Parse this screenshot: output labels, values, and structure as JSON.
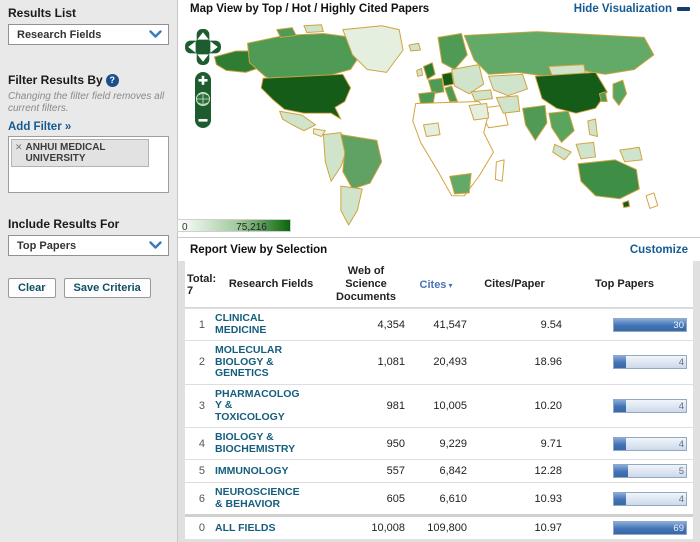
{
  "colors": {
    "link_blue": "#155a93",
    "cites_sort_blue": "#4a74b8",
    "field_link_teal": "#155e7d",
    "map_border_tan": "#d2a23c",
    "map_green_dark": "#145c17",
    "legend_gradient_end": "#0a650a",
    "bar_fill_blue": "#4273b4",
    "sidebar_bg": "#e9e9e9",
    "control_green": "#1d5c2e"
  },
  "sidebar": {
    "results_list_label": "Results List",
    "results_list_value": "Research Fields",
    "filter_heading": "Filter Results By",
    "filter_note": "Changing the filter field removes all current filters.",
    "add_filter_link": "Add Filter »",
    "filter_chip": "ANHUI MEDICAL UNIVERSITY",
    "include_results_label": "Include Results For",
    "include_results_value": "Top Papers",
    "clear_button": "Clear",
    "save_button": "Save Criteria"
  },
  "map": {
    "title": "Map View by Top / Hot / Highly Cited Papers",
    "hide_link": "Hide Visualization",
    "legend_min": "0",
    "legend_max": "75,216"
  },
  "report": {
    "title": "Report View by Selection",
    "customize_link": "Customize",
    "total_label": "Total:",
    "total_value": "7",
    "col_field": "Research Fields",
    "col_docs": "Web of Science Documents",
    "col_cites": "Cites",
    "col_cpp": "Cites/Paper",
    "col_top": "Top Papers",
    "rows": [
      {
        "rank": "1",
        "field": "CLINICAL\nMEDICINE",
        "docs": "4,354",
        "cites": "41,547",
        "cites_per_paper": "9.54",
        "top_papers": "30",
        "bar_fill": 100
      },
      {
        "rank": "2",
        "field": "MOLECULAR\nBIOLOGY &\nGENETICS",
        "docs": "1,081",
        "cites": "20,493",
        "cites_per_paper": "18.96",
        "top_papers": "4",
        "bar_fill": 17
      },
      {
        "rank": "3",
        "field": "PHARMACOLOG\nY &\nTOXICOLOGY",
        "docs": "981",
        "cites": "10,005",
        "cites_per_paper": "10.20",
        "top_papers": "4",
        "bar_fill": 17
      },
      {
        "rank": "4",
        "field": "BIOLOGY &\nBIOCHEMISTRY",
        "docs": "950",
        "cites": "9,229",
        "cites_per_paper": "9.71",
        "top_papers": "4",
        "bar_fill": 17
      },
      {
        "rank": "5",
        "field": "IMMUNOLOGY",
        "docs": "557",
        "cites": "6,842",
        "cites_per_paper": "12.28",
        "top_papers": "5",
        "bar_fill": 20
      },
      {
        "rank": "6",
        "field": "NEUROSCIENCE\n& BEHAVIOR",
        "docs": "605",
        "cites": "6,610",
        "cites_per_paper": "10.93",
        "top_papers": "4",
        "bar_fill": 17
      },
      {
        "rank": "0",
        "field": "ALL FIELDS",
        "docs": "10,008",
        "cites": "109,800",
        "cites_per_paper": "10.97",
        "top_papers": "69",
        "bar_fill": 100
      }
    ]
  }
}
